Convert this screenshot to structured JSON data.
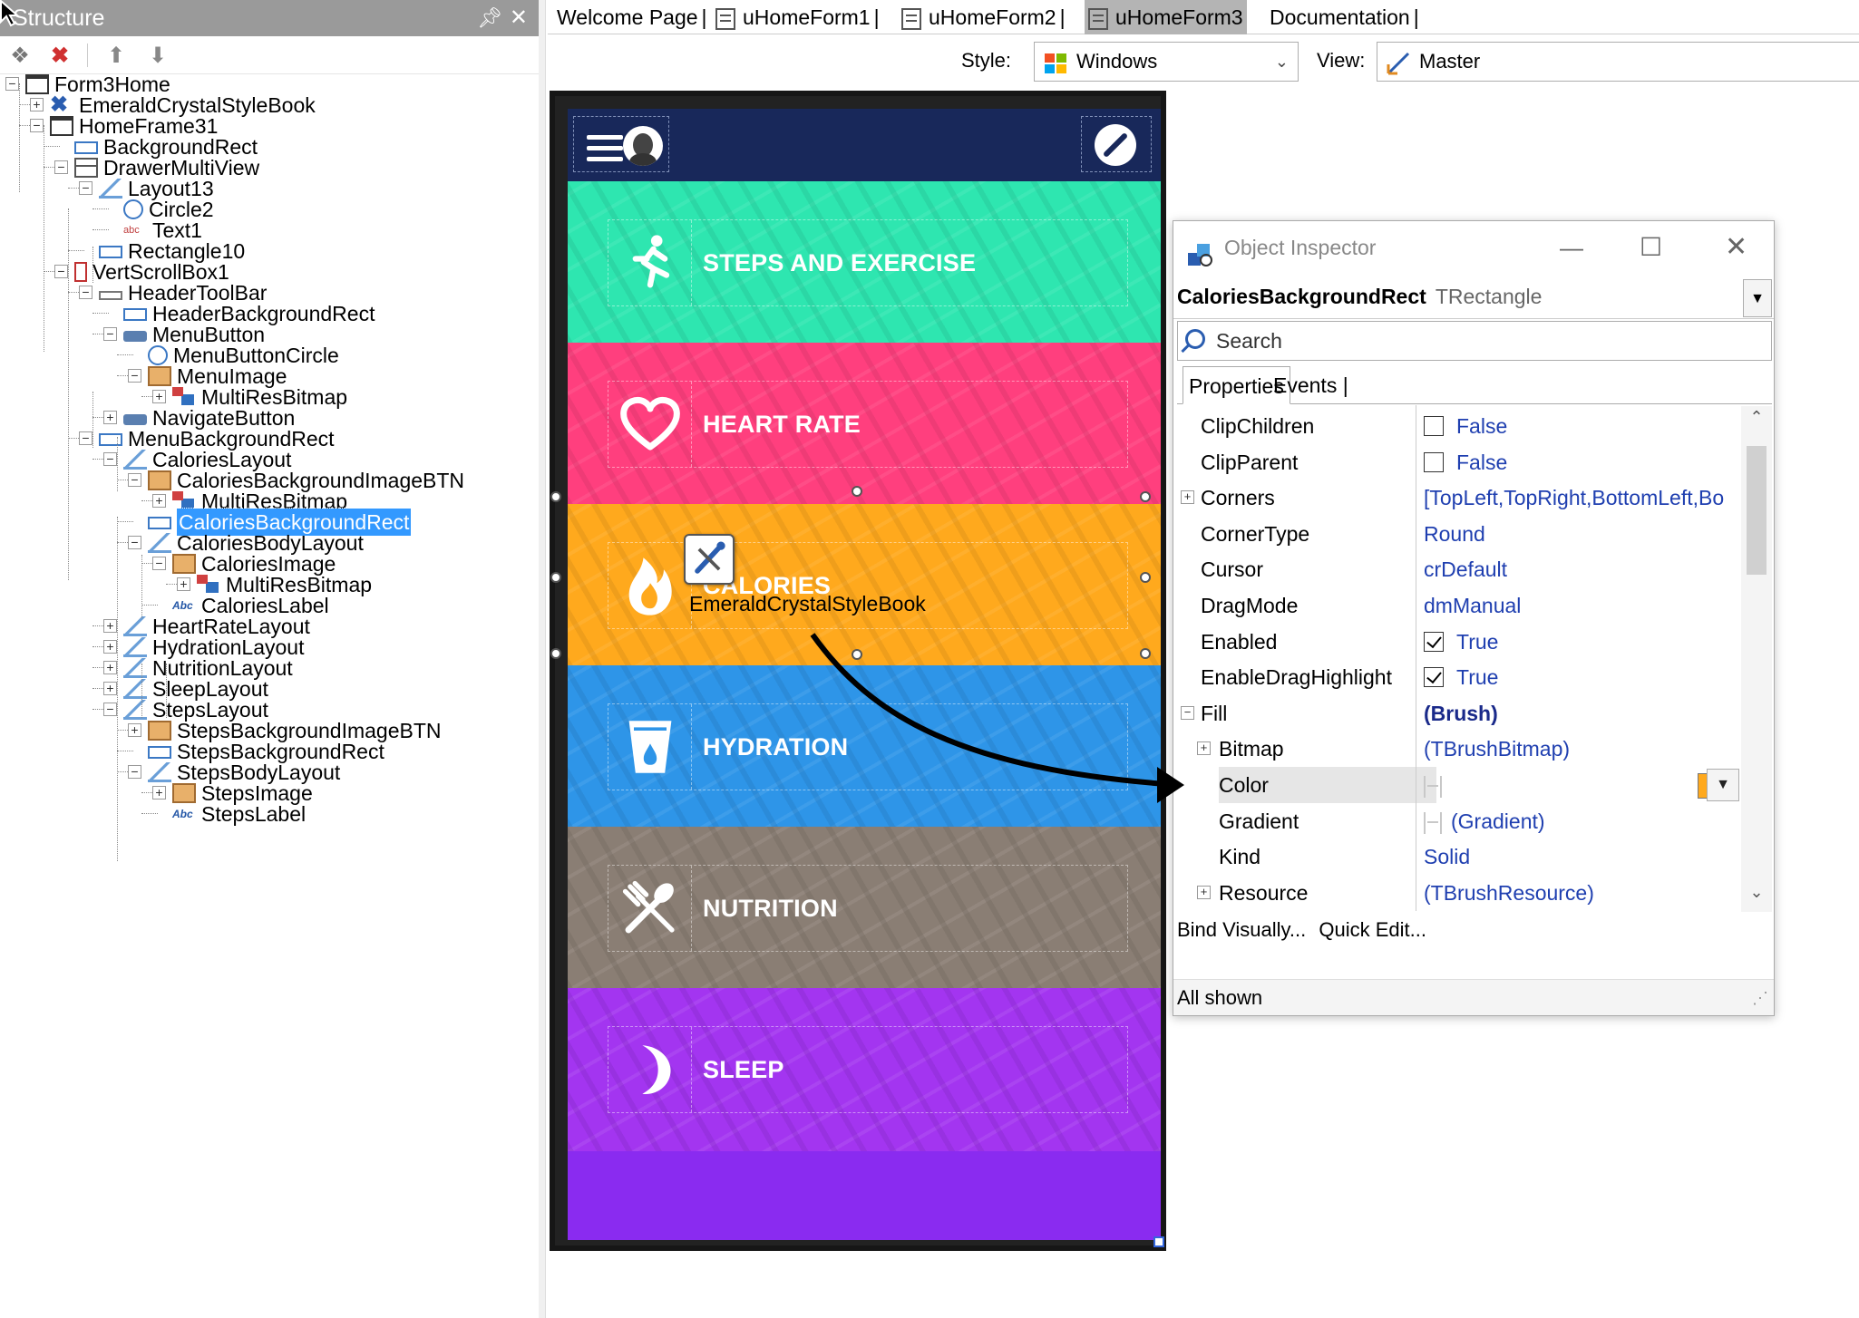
{
  "structure": {
    "title": "Structure",
    "nodes": [
      {
        "label": "Form3Home",
        "icon": "form-icon"
      },
      {
        "label": "EmeraldCrystalStyleBook",
        "icon": "stylebook-icon"
      },
      {
        "label": "HomeFrame31",
        "icon": "frame-icon"
      },
      {
        "label": "BackgroundRect",
        "icon": "rectangle-icon"
      },
      {
        "label": "DrawerMultiView",
        "icon": "multiview-icon"
      },
      {
        "label": "Layout13",
        "icon": "layout-icon"
      },
      {
        "label": "Circle2",
        "icon": "circle-icon"
      },
      {
        "label": "Text1",
        "icon": "text-icon"
      },
      {
        "label": "Rectangle10",
        "icon": "rectangle-icon"
      },
      {
        "label": "VertScrollBox1",
        "icon": "scrollbox-icon"
      },
      {
        "label": "HeaderToolBar",
        "icon": "toolbar-icon"
      },
      {
        "label": "HeaderBackgroundRect",
        "icon": "rectangle-icon"
      },
      {
        "label": "MenuButton",
        "icon": "button-icon"
      },
      {
        "label": "MenuButtonCircle",
        "icon": "circle-icon"
      },
      {
        "label": "MenuImage",
        "icon": "image-icon"
      },
      {
        "label": "MultiResBitmap",
        "icon": "multiresbitmap-icon"
      },
      {
        "label": "NavigateButton",
        "icon": "button-icon"
      },
      {
        "label": "MenuBackgroundRect",
        "icon": "rectangle-icon"
      },
      {
        "label": "CaloriesLayout",
        "icon": "layout-icon"
      },
      {
        "label": "CaloriesBackgroundImageBTN",
        "icon": "image-icon"
      },
      {
        "label": "MultiResBitmap",
        "icon": "multiresbitmap-icon"
      },
      {
        "label": "CaloriesBackgroundRect",
        "icon": "rectangle-icon"
      },
      {
        "label": "CaloriesBodyLayout",
        "icon": "layout-icon"
      },
      {
        "label": "CaloriesImage",
        "icon": "image-icon"
      },
      {
        "label": "MultiResBitmap",
        "icon": "multiresbitmap-icon"
      },
      {
        "label": "CaloriesLabel",
        "icon": "label-icon"
      },
      {
        "label": "HeartRateLayout",
        "icon": "layout-icon"
      },
      {
        "label": "HydrationLayout",
        "icon": "layout-icon"
      },
      {
        "label": "NutritionLayout",
        "icon": "layout-icon"
      },
      {
        "label": "SleepLayout",
        "icon": "layout-icon"
      },
      {
        "label": "StepsLayout",
        "icon": "layout-icon"
      },
      {
        "label": "StepsBackgroundImageBTN",
        "icon": "image-icon"
      },
      {
        "label": "StepsBackgroundRect",
        "icon": "rectangle-icon"
      },
      {
        "label": "StepsBodyLayout",
        "icon": "layout-icon"
      },
      {
        "label": "StepsImage",
        "icon": "image-icon"
      },
      {
        "label": "StepsLabel",
        "icon": "label-icon"
      }
    ],
    "selected_node": "CaloriesBackgroundRect"
  },
  "tabs": [
    {
      "label": "Welcome Page"
    },
    {
      "label": "uHomeForm1"
    },
    {
      "label": "uHomeForm2"
    },
    {
      "label": "uHomeForm3",
      "active": true
    },
    {
      "label": "Documentation"
    }
  ],
  "stylebar": {
    "style_label": "Style:",
    "style_value": "Windows",
    "view_label": "View:",
    "view_value": "Master"
  },
  "app": {
    "bands": [
      {
        "label": "STEPS AND EXERCISE",
        "color": "#2EE6B0",
        "icon": "running-icon"
      },
      {
        "label": "HEART RATE",
        "color": "#FF3F7E",
        "icon": "heart-icon"
      },
      {
        "label": "CALORIES",
        "color": "#FFA91D",
        "icon": "flame-icon"
      },
      {
        "label": "HYDRATION",
        "color": "#2E95E8",
        "icon": "water-glass-icon"
      },
      {
        "label": "NUTRITION",
        "color": "#8A7E74",
        "icon": "fork-knife-icon"
      },
      {
        "label": "SLEEP",
        "color": "#A335F0",
        "icon": "moon-icon"
      }
    ],
    "header_color": "#18285A",
    "bottom_color": "#8A2BF0",
    "drop_label": "EmeraldCrystalStyleBook"
  },
  "inspector": {
    "title": "Object Inspector",
    "object_name": "CaloriesBackgroundRect",
    "object_class": "TRectangle",
    "search_placeholder": "Search",
    "tab_properties": "Properties",
    "tab_events": "Events",
    "properties": [
      {
        "name": "ClipChildren",
        "value": "False",
        "checkbox": "off"
      },
      {
        "name": "ClipParent",
        "value": "False",
        "checkbox": "off"
      },
      {
        "name": "Corners",
        "value": "[TopLeft,TopRight,BottomLeft,Bo",
        "expandable": true
      },
      {
        "name": "CornerType",
        "value": "Round"
      },
      {
        "name": "Cursor",
        "value": "crDefault"
      },
      {
        "name": "DragMode",
        "value": "dmManual"
      },
      {
        "name": "Enabled",
        "value": "True",
        "checkbox": "on"
      },
      {
        "name": "EnableDragHighlight",
        "value": "True",
        "checkbox": "on"
      },
      {
        "name": "Fill",
        "value": "(Brush)",
        "expandable": true,
        "expanded": true,
        "bold": true
      },
      {
        "name": "Bitmap",
        "value": "(TBrushBitmap)",
        "expandable": true,
        "sub": true
      },
      {
        "name": "Color",
        "value": "#FFFFA91D",
        "sub": true,
        "highlight": true,
        "color_swatch": "#FFA91D"
      },
      {
        "name": "Gradient",
        "value": "(Gradient)",
        "sub": true,
        "bracket": true
      },
      {
        "name": "Kind",
        "value": "Solid",
        "sub": true
      },
      {
        "name": "Resource",
        "value": "(TBrushResource)",
        "expandable": true,
        "sub": true
      }
    ],
    "bind_visually": "Bind Visually...",
    "quick_edit": "Quick Edit...",
    "status": "All shown"
  }
}
